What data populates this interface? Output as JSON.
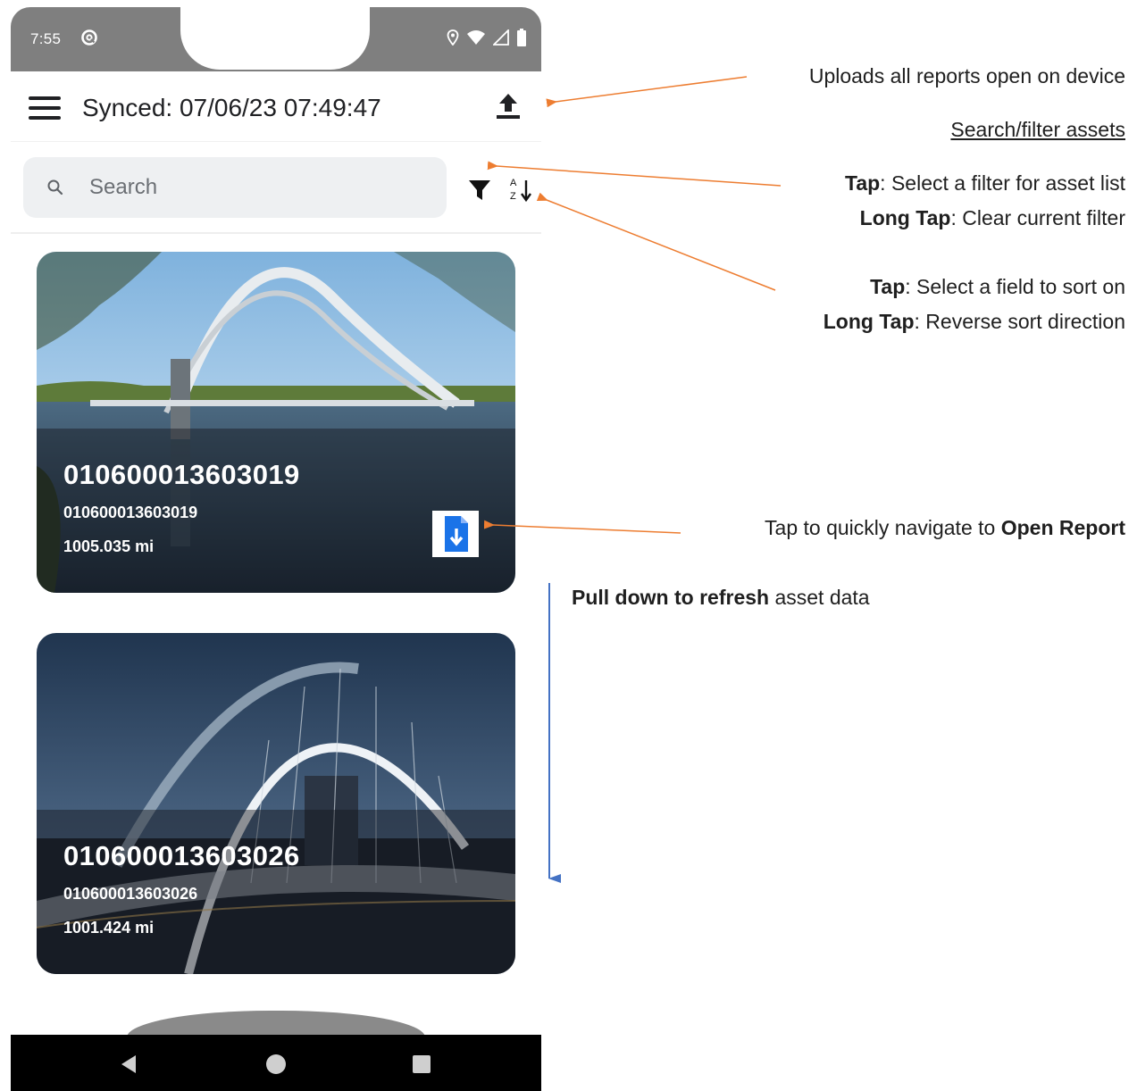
{
  "status_bar": {
    "time": "7:55",
    "left_icons": [
      "at-sign-icon"
    ],
    "right_icons": [
      "location-icon",
      "wifi-icon",
      "signal-icon",
      "battery-icon"
    ]
  },
  "app_bar": {
    "title": "Synced: 07/06/23 07:49:47",
    "menu_icon": "hamburger-menu-icon",
    "upload_icon": "upload-icon"
  },
  "search": {
    "placeholder": "Search",
    "value": ""
  },
  "assets": [
    {
      "title": "010600013603019",
      "id": "010600013603019",
      "distance": "1005.035 mi",
      "has_open_report": true
    },
    {
      "title": "010600013603026",
      "id": "010600013603026",
      "distance": "1001.424 mi",
      "has_open_report": false
    }
  ],
  "annotations": {
    "upload": "Uploads all reports open on device",
    "search_heading": "Search/filter assets",
    "filter_tap_bold": "Tap",
    "filter_tap_text": ": Select a filter for asset list",
    "filter_long_bold": "Long Tap",
    "filter_long_text": ": Clear current filter",
    "sort_tap_bold": "Tap",
    "sort_tap_text": ": Select a field to sort on",
    "sort_long_bold": "Long Tap",
    "sort_long_text": ": Reverse sort direction",
    "report_text": "Tap to quickly navigate to ",
    "report_bold": "Open Report",
    "refresh_bold": "Pull down to refresh",
    "refresh_text": " asset data"
  },
  "colors": {
    "annotation_arrow": "#ed7d31",
    "refresh_arrow": "#4472c4",
    "report_icon_blue": "#1a73e8",
    "status_bar": "#7f7f7f"
  }
}
